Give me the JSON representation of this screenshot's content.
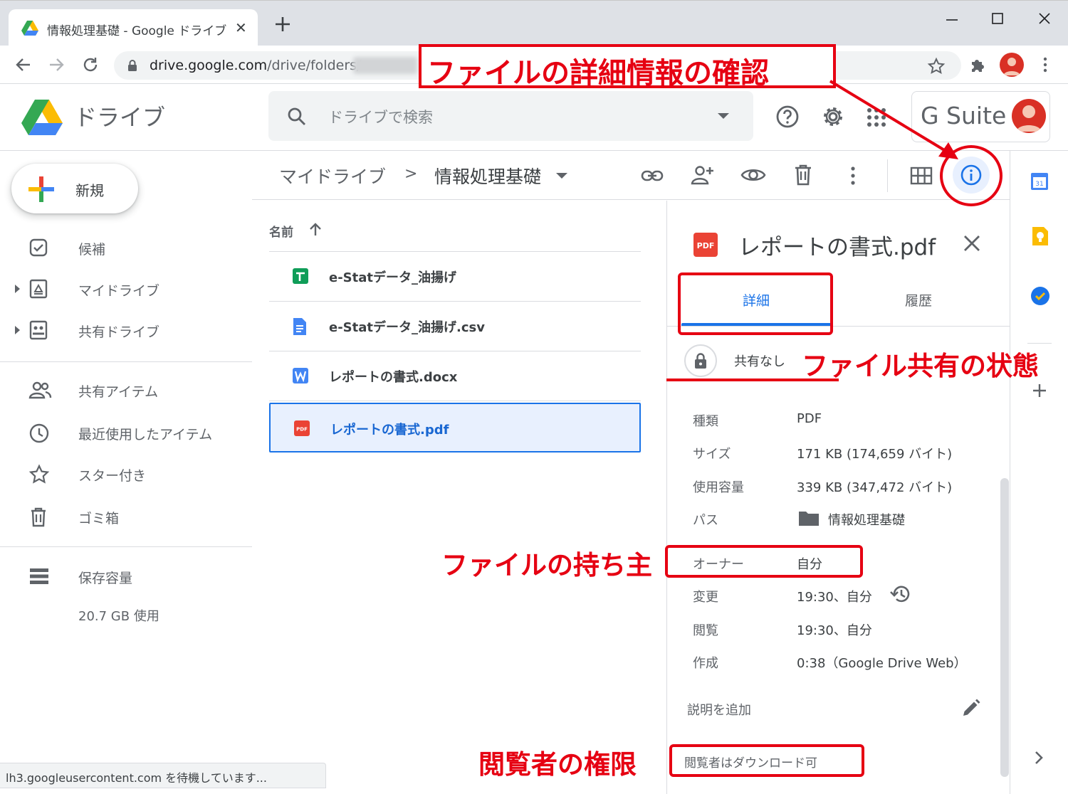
{
  "browser": {
    "tab_title": "情報処理基礎 - Google ドライブ",
    "url_host": "drive.google.com",
    "url_path": "/drive/folders/",
    "status": "lh3.googleusercontent.com を待機しています..."
  },
  "header": {
    "app_name": "ドライブ",
    "search_placeholder": "ドライブで検索",
    "gsuite": "G Suite"
  },
  "sidebar": {
    "new_label": "新規",
    "items": [
      {
        "label": "候補",
        "icon": "priority-icon"
      },
      {
        "label": "マイドライブ",
        "icon": "my-drive-icon"
      },
      {
        "label": "共有ドライブ",
        "icon": "shared-drive-icon"
      },
      {
        "label": "共有アイテム",
        "icon": "shared-with-me-icon"
      },
      {
        "label": "最近使用したアイテム",
        "icon": "recent-icon"
      },
      {
        "label": "スター付き",
        "icon": "star-icon"
      },
      {
        "label": "ゴミ箱",
        "icon": "trash-icon"
      },
      {
        "label": "保存容量",
        "icon": "storage-icon"
      }
    ],
    "storage_used": "20.7 GB 使用"
  },
  "breadcrumb": {
    "root": "マイドライブ",
    "separator": ">",
    "current": "情報処理基礎"
  },
  "file_list": {
    "column_name": "名前",
    "files": [
      {
        "name": "e-Statデータ_油揚げ",
        "icon": "sheets-icon"
      },
      {
        "name": "e-Statデータ_油揚げ.csv",
        "icon": "docs-icon"
      },
      {
        "name": "レポートの書式.docx",
        "icon": "word-icon"
      },
      {
        "name": "レポートの書式.pdf",
        "icon": "pdf-icon"
      }
    ]
  },
  "details": {
    "file_title": "レポートの書式.pdf",
    "tabs": [
      "詳細",
      "履歴"
    ],
    "share_status": "共有なし",
    "properties": [
      {
        "key": "種類",
        "value": "PDF"
      },
      {
        "key": "サイズ",
        "value": "171 KB (174,659 バイト)"
      },
      {
        "key": "使用容量",
        "value": "339 KB (347,472 バイト)"
      },
      {
        "key": "パス",
        "value": "情報処理基礎"
      },
      {
        "key": "オーナー",
        "value": "自分"
      },
      {
        "key": "変更",
        "value": "19:30、自分"
      },
      {
        "key": "閲覧",
        "value": "19:30、自分"
      },
      {
        "key": "作成",
        "value": "0:38（Google Drive Web）"
      }
    ],
    "description_add": "説明を追加",
    "viewer_permission": "閲覧者はダウンロード可"
  },
  "annotations": {
    "title": "ファイルの詳細情報の確認",
    "share_state": "ファイル共有の状態",
    "owner": "ファイルの持ち主",
    "viewer": "閲覧者の権限"
  },
  "colors": {
    "accent_blue": "#1a73e8",
    "annotation_red": "#e60012"
  }
}
